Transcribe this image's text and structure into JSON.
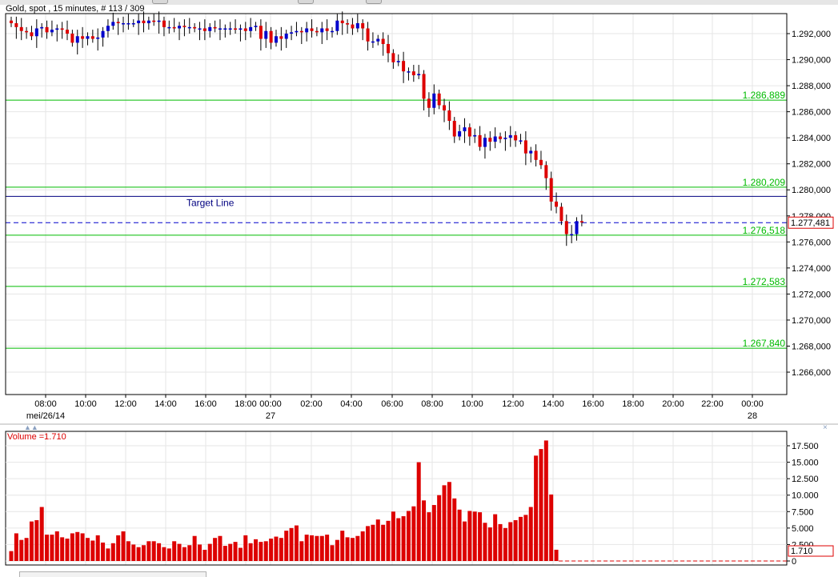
{
  "header": {
    "title": "Gold, spot , 15 minutes, # 113 / 309"
  },
  "colors": {
    "up": "#0000cc",
    "down": "#dd0000",
    "level": "#00bb00",
    "target": "#000080",
    "current": "#0000cc",
    "volume": "#dd0000",
    "grid": "#e6e6e6"
  },
  "chart_data": [
    {
      "type": "candlestick",
      "title": "Gold, spot , 15 minutes, # 113 / 309",
      "ylim": [
        1.2645,
        1.2935
      ],
      "y_ticks": [
        "1.292,000",
        "1.290,000",
        "1.288,000",
        "1.286,000",
        "1.284,000",
        "1.282,000",
        "1.280,000",
        "1.278,000",
        "1.276,000",
        "1.274,000",
        "1.272,000",
        "1.270,000",
        "1.268,000",
        "1.266,000"
      ],
      "x_ticks": [
        "08:00",
        "10:00",
        "12:00",
        "14:00",
        "16:00",
        "18:00",
        "00:00",
        "02:00",
        "04:00",
        "06:00",
        "08:00",
        "10:00",
        "12:00",
        "14:00",
        "16:00",
        "18:00",
        "20:00",
        "22:00",
        "00:00"
      ],
      "date_labels": [
        "mei/26/14",
        "27",
        "28"
      ],
      "current_price": "1.277,481",
      "target_line": {
        "label": "Target Line",
        "value": 1.2795
      },
      "levels": [
        {
          "label": "1.286,889",
          "value": 1.286889
        },
        {
          "label": "1.280,209",
          "value": 1.280209
        },
        {
          "label": "1.276,518",
          "value": 1.276518
        },
        {
          "label": "1.272,583",
          "value": 1.272583
        },
        {
          "label": "1.267,840",
          "value": 1.26784
        }
      ],
      "closes": [
        1.2928,
        1.2925,
        1.2922,
        1.2921,
        1.2918,
        1.2924,
        1.2925,
        1.2921,
        1.2923,
        1.2924,
        1.2923,
        1.292,
        1.2913,
        1.2918,
        1.2916,
        1.2918,
        1.2916,
        1.2917,
        1.2922,
        1.2926,
        1.2929,
        1.2928,
        1.2928,
        1.2928,
        1.2928,
        1.293,
        1.2928,
        1.293,
        1.2929,
        1.293,
        1.2925,
        1.2925,
        1.2924,
        1.2926,
        1.2925,
        1.2925,
        1.2924,
        1.2924,
        1.2922,
        1.2925,
        1.2924,
        1.2924,
        1.2924,
        1.2924,
        1.2923,
        1.2924,
        1.2922,
        1.2925,
        1.2926,
        1.2916,
        1.2922,
        1.2913,
        1.2918,
        1.2916,
        1.292,
        1.2921,
        1.2922,
        1.2921,
        1.2924,
        1.2922,
        1.2921,
        1.2924,
        1.2922,
        1.2922,
        1.293,
        1.2928,
        1.2927,
        1.2924,
        1.2928,
        1.2924,
        1.2914,
        1.2914,
        1.2916,
        1.2912,
        1.2905,
        1.2898,
        1.2899,
        1.2891,
        1.2891,
        1.2888,
        1.2889,
        1.287,
        1.2863,
        1.2874,
        1.2865,
        1.2861,
        1.2853,
        1.2841,
        1.2845,
        1.2848,
        1.2841,
        1.2842,
        1.2833,
        1.284,
        1.2837,
        1.2841,
        1.2839,
        1.284,
        1.2842,
        1.2838,
        1.2838,
        1.2828,
        1.283,
        1.2823,
        1.2819,
        1.2809,
        1.2791,
        1.2787,
        1.2776,
        1.2766,
        1.2766,
        1.2776,
        1.2775
      ],
      "volume": {
        "label": "Volume =1.710",
        "current": "1.710",
        "ylim": [
          0,
          18500
        ],
        "y_ticks": [
          "17.500",
          "15.000",
          "12.500",
          "10.000",
          "7.500",
          "5.000",
          "2.500",
          "0"
        ],
        "values": [
          1500,
          4200,
          3200,
          3500,
          6000,
          6200,
          8200,
          4000,
          4000,
          4500,
          3600,
          3400,
          4200,
          4400,
          4200,
          3500,
          3100,
          3900,
          2800,
          1900,
          2700,
          3900,
          4500,
          3000,
          2500,
          2100,
          2400,
          3000,
          3000,
          2700,
          2100,
          1900,
          3000,
          2600,
          2100,
          2400,
          3800,
          2500,
          1700,
          2600,
          3500,
          3800,
          2300,
          2600,
          2900,
          2000,
          3900,
          2700,
          3300,
          2900,
          3000,
          3400,
          3700,
          3500,
          4600,
          5000,
          5400,
          3000,
          4000,
          3900,
          3800,
          3800,
          4000,
          2400,
          3200,
          4600,
          3600,
          3500,
          3800,
          4500,
          5300,
          5500,
          6300,
          5500,
          6100,
          7500,
          6500,
          6800,
          7600,
          8300,
          15000,
          9200,
          7400,
          8500,
          10000,
          11500,
          12000,
          9500,
          7800,
          6000,
          7600,
          7500,
          7400,
          5800,
          5100,
          7100,
          5600,
          5000,
          5900,
          6200,
          6700,
          7000,
          8200,
          16000,
          17000,
          18300,
          10100,
          1710
        ]
      }
    }
  ]
}
